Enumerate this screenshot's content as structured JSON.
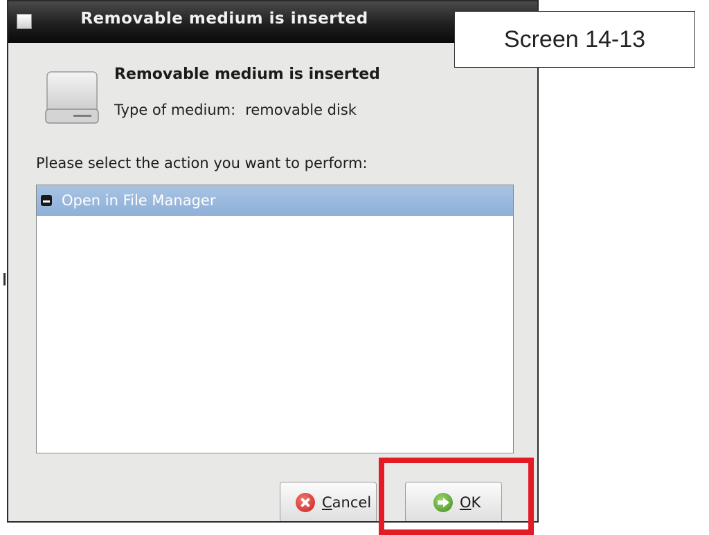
{
  "window": {
    "title": "Removable medium is inserted",
    "heading": "Removable medium is inserted",
    "type_label": "Type of medium:",
    "type_value": "removable disk",
    "prompt": "Please select the action you want to perform:",
    "actions": [
      {
        "label": "Open in File Manager",
        "icon": "file-manager-icon",
        "selected": true
      }
    ],
    "buttons": {
      "cancel": {
        "label": "Cancel",
        "icon": "cancel-icon"
      },
      "ok": {
        "label": "OK",
        "icon": "ok-icon"
      }
    }
  },
  "annotation": {
    "screen_label": "Screen 14-13",
    "highlight_color": "#e21b24"
  },
  "colors": {
    "selection": "#9db9df",
    "titlebar": "#1f1f1f"
  }
}
